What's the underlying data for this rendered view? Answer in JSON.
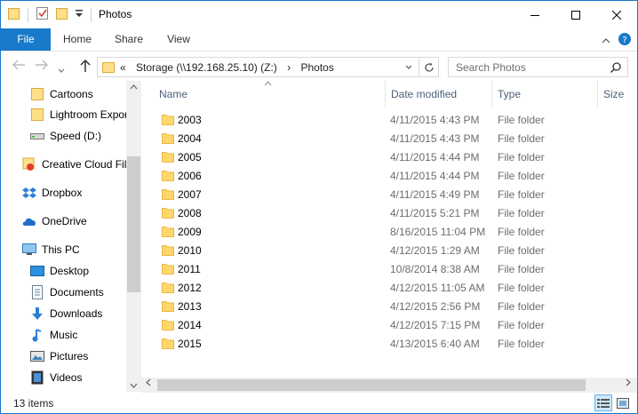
{
  "window": {
    "title": "Photos"
  },
  "ribbon": {
    "tabs": [
      {
        "label": "File"
      },
      {
        "label": "Home"
      },
      {
        "label": "Share"
      },
      {
        "label": "View"
      }
    ]
  },
  "address": {
    "prefix": "«",
    "segments": [
      "Storage (\\\\192.168.25.10) (Z:)",
      "Photos"
    ],
    "separator": "›"
  },
  "search": {
    "placeholder": "Search Photos"
  },
  "nav": {
    "items": [
      {
        "label": "Cartoons",
        "icon": "folder-icon"
      },
      {
        "label": "Lightroom Expor",
        "icon": "folder-icon"
      },
      {
        "label": "Speed (D:)",
        "icon": "drive-icon"
      },
      {
        "label": "Creative Cloud Fil",
        "icon": "creative-cloud-icon"
      },
      {
        "label": "Dropbox",
        "icon": "dropbox-icon"
      },
      {
        "label": "OneDrive",
        "icon": "onedrive-icon"
      },
      {
        "label": "This PC",
        "icon": "this-pc-icon"
      },
      {
        "label": "Desktop",
        "icon": "desktop-icon"
      },
      {
        "label": "Documents",
        "icon": "documents-icon"
      },
      {
        "label": "Downloads",
        "icon": "downloads-icon"
      },
      {
        "label": "Music",
        "icon": "music-icon"
      },
      {
        "label": "Pictures",
        "icon": "pictures-icon"
      },
      {
        "label": "Videos",
        "icon": "videos-icon"
      }
    ]
  },
  "columns": {
    "name": "Name",
    "date": "Date modified",
    "type": "Type",
    "size": "Size"
  },
  "files": [
    {
      "name": "2003",
      "date": "4/11/2015 4:43 PM",
      "type": "File folder"
    },
    {
      "name": "2004",
      "date": "4/11/2015 4:43 PM",
      "type": "File folder"
    },
    {
      "name": "2005",
      "date": "4/11/2015 4:44 PM",
      "type": "File folder"
    },
    {
      "name": "2006",
      "date": "4/11/2015 4:44 PM",
      "type": "File folder"
    },
    {
      "name": "2007",
      "date": "4/11/2015 4:49 PM",
      "type": "File folder"
    },
    {
      "name": "2008",
      "date": "4/11/2015 5:21 PM",
      "type": "File folder"
    },
    {
      "name": "2009",
      "date": "8/16/2015 11:04 PM",
      "type": "File folder"
    },
    {
      "name": "2010",
      "date": "4/12/2015 1:29 AM",
      "type": "File folder"
    },
    {
      "name": "2011",
      "date": "10/8/2014 8:38 AM",
      "type": "File folder"
    },
    {
      "name": "2012",
      "date": "4/12/2015 11:05 AM",
      "type": "File folder"
    },
    {
      "name": "2013",
      "date": "4/12/2015 2:56 PM",
      "type": "File folder"
    },
    {
      "name": "2014",
      "date": "4/12/2015 7:15 PM",
      "type": "File folder"
    },
    {
      "name": "2015",
      "date": "4/13/2015 6:40 AM",
      "type": "File folder"
    }
  ],
  "status": {
    "items": "13 items"
  },
  "colors": {
    "accent": "#1979ca",
    "folder": "#ffd86b",
    "folderDark": "#e8b64a"
  }
}
